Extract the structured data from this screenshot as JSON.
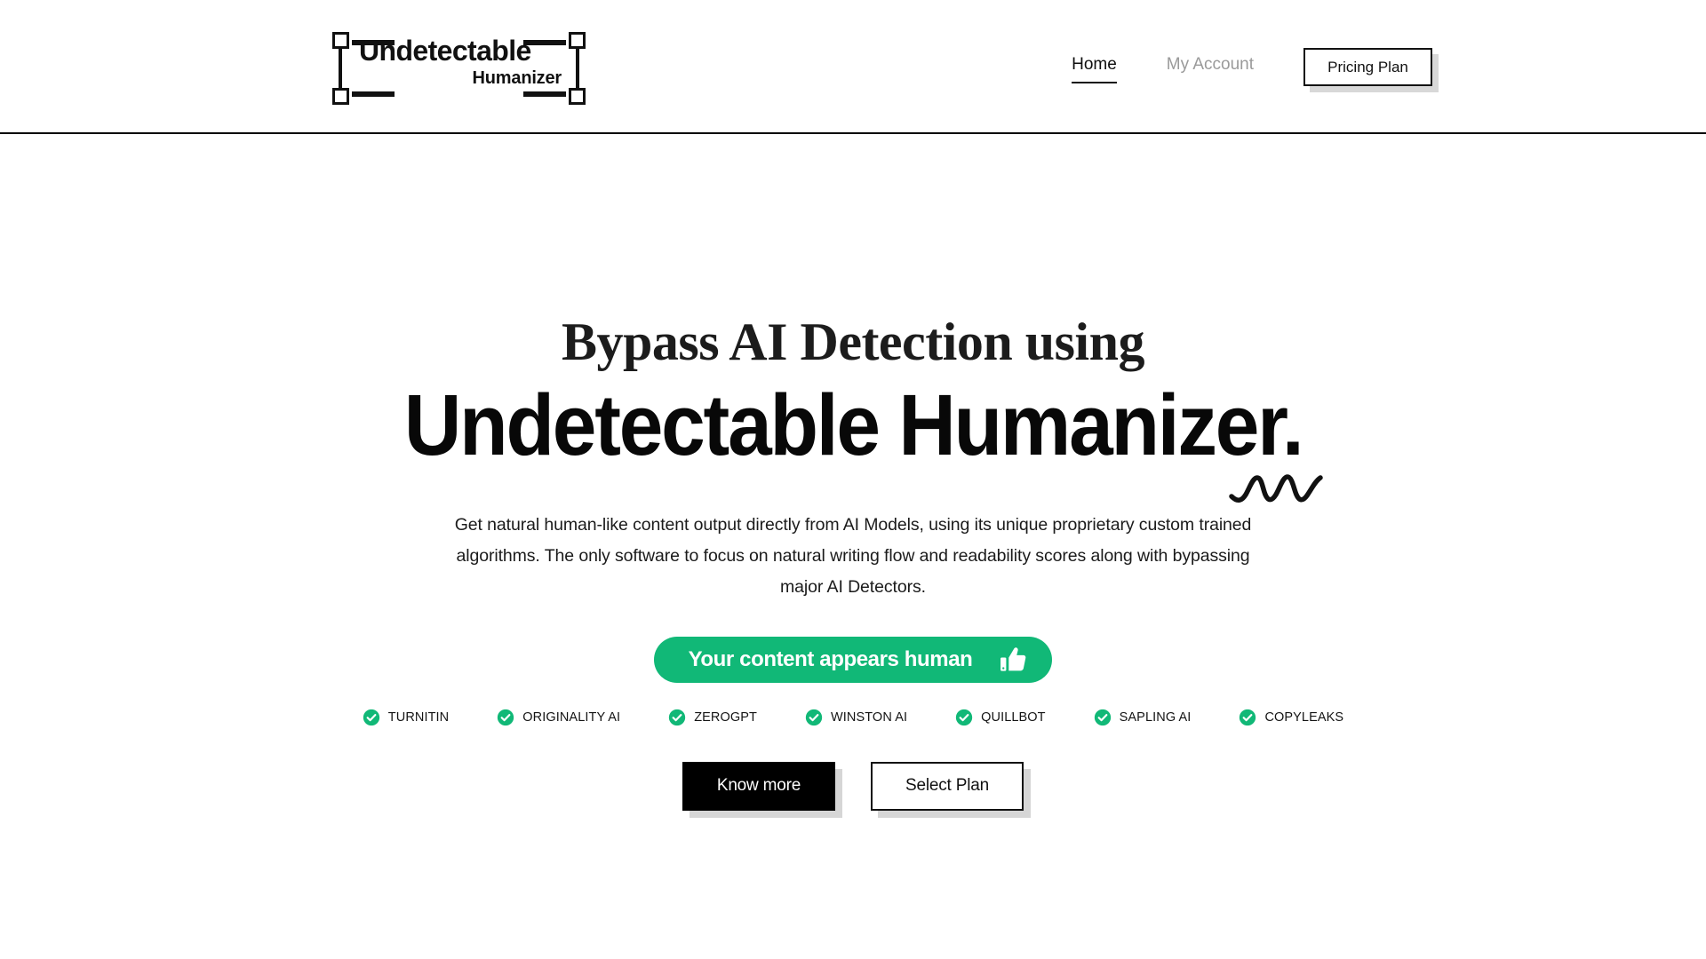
{
  "brand": {
    "logo_main": "Undetectable",
    "logo_sub": "Humanizer",
    "accent_green": "#11b877",
    "ink": "#111111"
  },
  "header": {
    "nav": [
      {
        "label": "Home",
        "active": true
      },
      {
        "label": "My Account",
        "active": false
      }
    ],
    "pricing_button": "Pricing Plan"
  },
  "hero": {
    "headline_line1": "Bypass AI Detection using",
    "headline_line2": "Undetectable Humanizer.",
    "paragraph": "Get natural human-like content output directly from AI Models, using its unique proprietary custom trained algorithms. The only software to focus on natural writing flow and readability scores along with bypassing major AI Detectors.",
    "badge_text": "Your content appears human",
    "badge_icon": "thumbs-up-icon",
    "detectors": [
      "TURNITIN",
      "ORIGINALITY AI",
      "ZEROGPT",
      "WINSTON AI",
      "QUILLBOT",
      "SAPLING AI",
      "COPYLEAKS"
    ],
    "cta_primary": "Know more",
    "cta_secondary": "Select Plan"
  }
}
